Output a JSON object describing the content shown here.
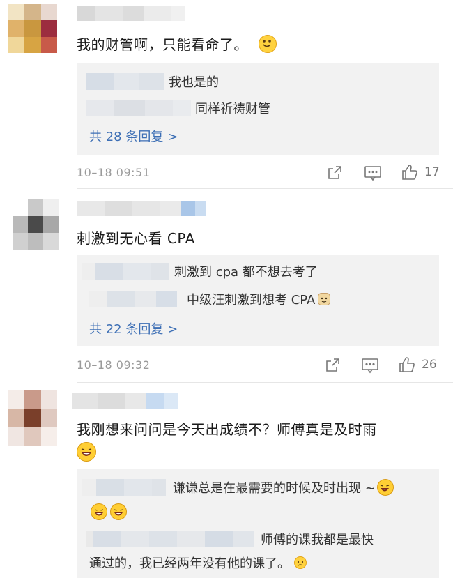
{
  "comments": [
    {
      "text": "我的财管啊，只能看命了。",
      "emoji_end": "smile-emoji",
      "replies": [
        {
          "text": "我也是的"
        },
        {
          "text": "同样祈祷财管"
        }
      ],
      "more_replies": "共 28 条回复 >",
      "timestamp": "10–18  09:51",
      "likes": "17"
    },
    {
      "text": "刺激到无心看 CPA",
      "replies": [
        {
          "text": "刺激到 cpa 都不想去考了"
        },
        {
          "text": "中级汪刺激到想考 CPA",
          "emoji_end": "doge-emoji"
        }
      ],
      "more_replies": "共 22 条回复 >",
      "timestamp": "10–18  09:32",
      "likes": "26"
    },
    {
      "text": "我刚想来问问是今天出成绩不？师傅真是及时雨",
      "emoji_end": "laughing-emoji",
      "replies": [
        {
          "text": "谦谦总是在最需要的时候及时出现 ~",
          "emoji_end": "laughing-emoji"
        },
        {
          "text": "师傅的课我都是最快",
          "continuation": "通过的，我已经两年没有他的课了。",
          "emoji_end": "sad-emoji"
        }
      ]
    }
  ],
  "colors": {
    "link_blue": "#3d6fb5",
    "meta_gray": "#9a9a9a",
    "reply_bg": "#f2f2f2"
  }
}
